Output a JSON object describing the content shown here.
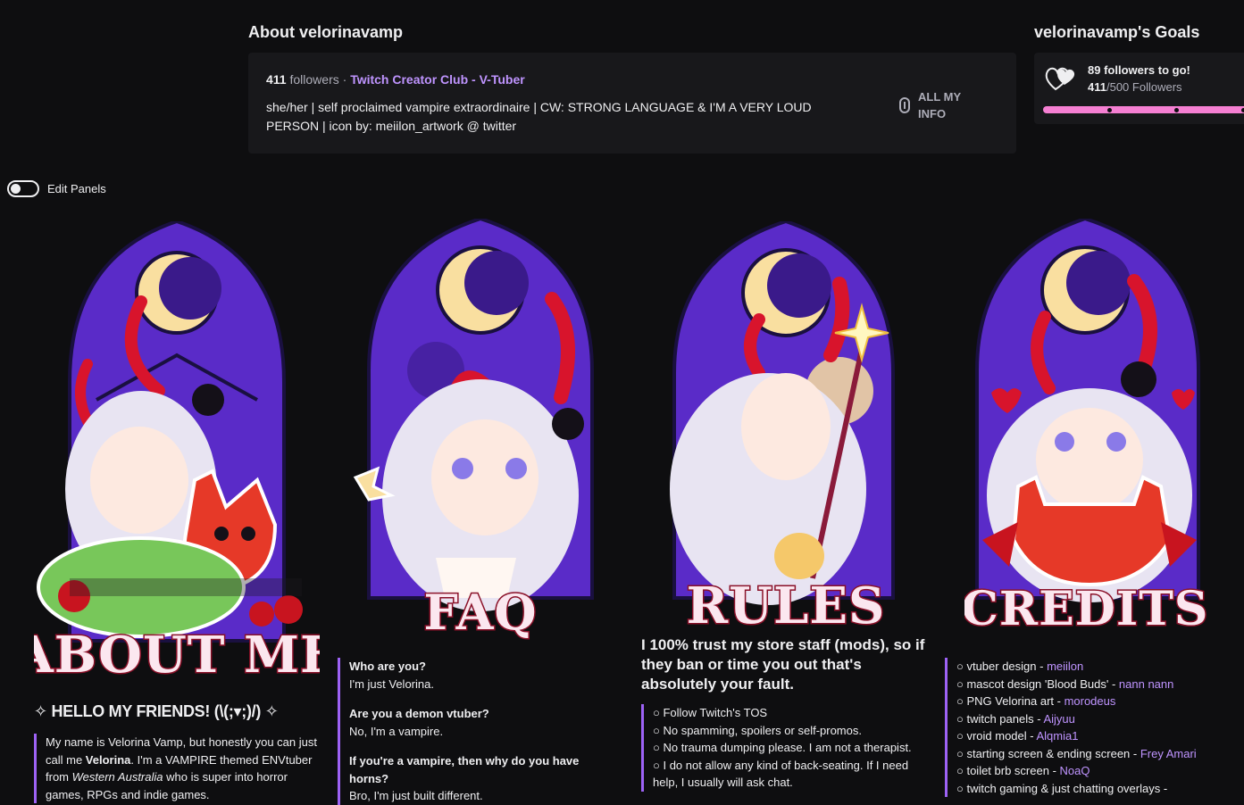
{
  "about": {
    "title": "About velorinavamp",
    "followers_count": "411",
    "followers_label": "followers",
    "separator": "·",
    "club": "Twitch Creator Club - V-Tuber",
    "bio": "she/her | self proclaimed vampire extraordinaire | CW: STRONG LANGUAGE & I'M A VERY LOUD PERSON | icon by: meiilon_artwork @ twitter",
    "all_info_line1": "ALL MY",
    "all_info_line2": "INFO"
  },
  "goals": {
    "title": "velorinavamp's Goals",
    "main": "89 followers to go!",
    "current": "411",
    "target_suffix": "/500 Followers",
    "progress": 0.822
  },
  "edit_panels": {
    "label": "Edit Panels",
    "enabled": false
  },
  "panels": {
    "about": {
      "title": "ABOUT ME",
      "hello": "✧ HELLO MY FRIENDS! (\\(;▾;)/) ✧",
      "desc_1": "My name is Velorina Vamp, but honestly you can just call me ",
      "desc_name": "Velorina",
      "desc_2": ". I'm a VAMPIRE themed ENVtuber from ",
      "desc_place": "Western Australia",
      "desc_3": " who is super into horror games, RPGs and indie games."
    },
    "faq": {
      "title": "FAQ",
      "items": [
        {
          "q": "Who are you?",
          "a": "I'm just Velorina."
        },
        {
          "q": "Are you a demon vtuber?",
          "a": "No, I'm a vampire."
        },
        {
          "q": "If you're a vampire, then why do you have horns?",
          "a": "Bro, I'm just built different."
        }
      ]
    },
    "rules": {
      "title": "RULES",
      "headline": "I 100% trust my store staff (mods), so if they ban or time you out that's absolutely your fault.",
      "items": [
        "○ Follow Twitch's TOS",
        "○ No spamming, spoilers or self-promos.",
        "○ No trauma dumping please. I am not a therapist.",
        "○ I do not allow any kind of back-seating. If I need",
        "help, I usually will ask chat."
      ]
    },
    "credits": {
      "title": "CREDITS",
      "items": [
        {
          "label": "○ vtuber design - ",
          "name": "meiilon"
        },
        {
          "label": "○ mascot design 'Blood Buds' - ",
          "name": "nann nann"
        },
        {
          "label": "○ PNG Velorina art - ",
          "name": "morodeus"
        },
        {
          "label": "○ twitch panels - ",
          "name": "Aijyuu"
        },
        {
          "label": "○ vroid model - ",
          "name": "Alqmia1"
        },
        {
          "label": "○ starting screen & ending screen - ",
          "name": "Frey Amari"
        },
        {
          "label": "○ toilet brb screen - ",
          "name": "NoaQ"
        },
        {
          "label": "○ twitch gaming & just chatting overlays - ",
          "name": ""
        }
      ]
    }
  },
  "colors": {
    "accent": "#bf94ff",
    "goal_bar": "#f57fd2",
    "panel_window": "#5a2bc8",
    "horn": "#d8142c"
  }
}
